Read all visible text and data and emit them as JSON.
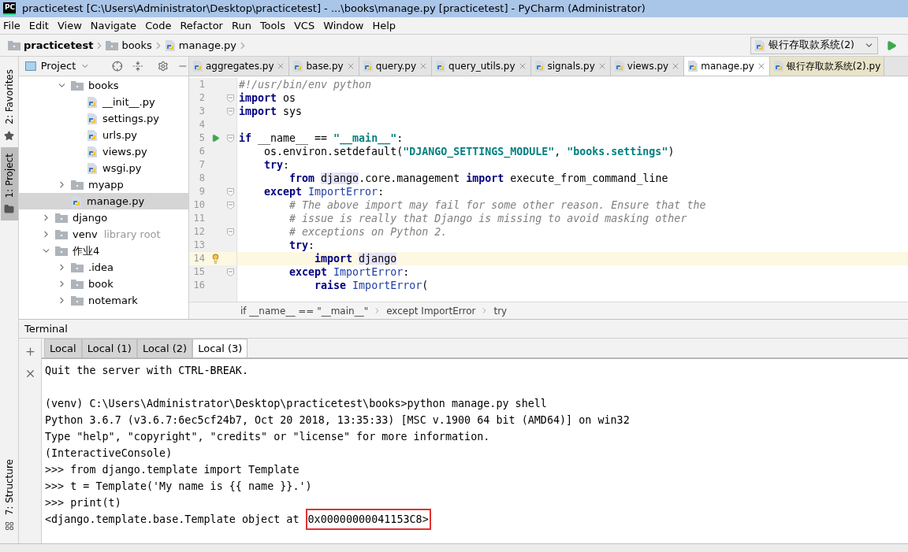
{
  "window": {
    "app_icon": "PC",
    "title": "practicetest [C:\\Users\\Administrator\\Desktop\\practicetest] - ...\\books\\manage.py [practicetest] - PyCharm (Administrator)"
  },
  "menu": [
    "File",
    "Edit",
    "View",
    "Navigate",
    "Code",
    "Refactor",
    "Run",
    "Tools",
    "VCS",
    "Window",
    "Help"
  ],
  "nav_path": [
    {
      "label": "practicetest",
      "kind": "root"
    },
    {
      "label": "books",
      "kind": "folder"
    },
    {
      "label": "manage.py",
      "kind": "python"
    }
  ],
  "run_config": "银行存取款系统(2)",
  "left_stripe": [
    {
      "label": "2: Favorites",
      "kind": "star",
      "selected": false
    },
    {
      "label": "1: Project",
      "kind": "folder",
      "selected": true
    }
  ],
  "bottom_stripe": [
    {
      "label": "7: Structure",
      "kind": "structure",
      "selected": false
    }
  ],
  "project_panel": {
    "title": "Project",
    "scrolled_group": [
      {
        "label": "books",
        "kind": "folder",
        "expanded": true,
        "selected": false,
        "children": [
          {
            "label": "__init__.py",
            "kind": "python",
            "selected": false
          },
          {
            "label": "settings.py",
            "kind": "python",
            "selected": false
          },
          {
            "label": "urls.py",
            "kind": "python",
            "selected": false
          },
          {
            "label": "views.py",
            "kind": "python",
            "selected": false
          },
          {
            "label": "wsgi.py",
            "kind": "python",
            "selected": false
          }
        ]
      },
      {
        "label": "myapp",
        "kind": "folder",
        "expanded": false,
        "selected": false
      },
      {
        "label": "manage.py",
        "kind": "python",
        "selected": true
      }
    ],
    "items": [
      {
        "label": "django",
        "kind": "folder",
        "expanded": false,
        "selected": false
      },
      {
        "label": "venv",
        "hint": "library root",
        "kind": "folder",
        "expanded": false,
        "selected": false
      },
      {
        "label": "作业4",
        "kind": "folder",
        "expanded": true,
        "selected": false,
        "children": [
          {
            "label": ".idea",
            "kind": "folder",
            "expanded": false,
            "selected": false
          },
          {
            "label": "book",
            "kind": "folder",
            "expanded": false,
            "selected": false
          },
          {
            "label": "notemark",
            "kind": "folder",
            "expanded": false,
            "selected": false
          }
        ]
      }
    ]
  },
  "editor_tabs": [
    {
      "label": "aggregates.py",
      "kind": "project",
      "selected": false
    },
    {
      "label": "base.py",
      "kind": "project",
      "selected": false
    },
    {
      "label": "query.py",
      "kind": "project",
      "selected": false
    },
    {
      "label": "query_utils.py",
      "kind": "project",
      "selected": false
    },
    {
      "label": "signals.py",
      "kind": "project",
      "selected": false
    },
    {
      "label": "views.py",
      "kind": "project",
      "selected": false
    },
    {
      "label": "manage.py",
      "kind": "project",
      "selected": true
    },
    {
      "label": "银行存取款系统(2).py",
      "kind": "other",
      "selected": false
    }
  ],
  "code_lines": [
    {
      "n": "1",
      "fold": false,
      "runnable": false,
      "intention": false,
      "current": false,
      "tokens": [
        {
          "t": "#!/usr/bin/env python",
          "kind": "comment"
        }
      ]
    },
    {
      "n": "2",
      "fold": true,
      "runnable": false,
      "intention": false,
      "current": false,
      "tokens": [
        {
          "t": "import ",
          "kind": "keyword"
        },
        {
          "t": "os",
          "kind": "plain"
        }
      ]
    },
    {
      "n": "3",
      "fold": true,
      "runnable": false,
      "intention": false,
      "current": false,
      "tokens": [
        {
          "t": "import ",
          "kind": "keyword"
        },
        {
          "t": "sys",
          "kind": "plain"
        }
      ]
    },
    {
      "n": "4",
      "fold": false,
      "runnable": false,
      "intention": false,
      "current": false
    },
    {
      "n": "5",
      "fold": true,
      "runnable": true,
      "intention": false,
      "current": false,
      "tokens": [
        {
          "t": "if",
          "kind": "keyword"
        },
        {
          "t": " __name__ == ",
          "kind": "plain"
        },
        {
          "t": "\"__main__\"",
          "kind": "string"
        },
        {
          "t": ":",
          "kind": "plain"
        }
      ]
    },
    {
      "n": "6",
      "fold": false,
      "runnable": false,
      "intention": false,
      "current": false,
      "tokens": [
        {
          "t": "    os.environ.setdefault(",
          "kind": "plain"
        },
        {
          "t": "\"DJANGO_SETTINGS_MODULE\"",
          "kind": "string"
        },
        {
          "t": ", ",
          "kind": "plain"
        },
        {
          "t": "\"books.settings\"",
          "kind": "string"
        },
        {
          "t": ")",
          "kind": "plain"
        }
      ]
    },
    {
      "n": "7",
      "fold": false,
      "runnable": false,
      "intention": false,
      "current": false,
      "tokens": [
        {
          "t": "    try",
          "kind": "keyword"
        },
        {
          "t": ":",
          "kind": "plain"
        }
      ]
    },
    {
      "n": "8",
      "fold": false,
      "runnable": false,
      "intention": false,
      "current": false,
      "tokens": [
        {
          "t": "        from ",
          "kind": "keyword"
        },
        {
          "t": "django",
          "kind": "usage"
        },
        {
          "t": ".core.management ",
          "kind": "plain"
        },
        {
          "t": "import",
          "kind": "keyword"
        },
        {
          "t": " execute_from_command_line",
          "kind": "plain"
        }
      ]
    },
    {
      "n": "9",
      "fold": true,
      "runnable": false,
      "intention": false,
      "current": false,
      "tokens": [
        {
          "t": "    except ",
          "kind": "keyword"
        },
        {
          "t": "ImportError",
          "kind": "builtin"
        },
        {
          "t": ":",
          "kind": "plain"
        }
      ]
    },
    {
      "n": "10",
      "fold": true,
      "runnable": false,
      "intention": false,
      "current": false,
      "tokens": [
        {
          "t": "        # The above import may fail for some other reason. Ensure that the",
          "kind": "comment"
        }
      ]
    },
    {
      "n": "11",
      "fold": false,
      "runnable": false,
      "intention": false,
      "current": false,
      "tokens": [
        {
          "t": "        # issue is really that Django is missing to avoid masking other",
          "kind": "comment"
        }
      ]
    },
    {
      "n": "12",
      "fold": true,
      "runnable": false,
      "intention": false,
      "current": false,
      "tokens": [
        {
          "t": "        # exceptions on Python 2.",
          "kind": "comment"
        }
      ]
    },
    {
      "n": "13",
      "fold": false,
      "runnable": false,
      "intention": false,
      "current": false,
      "tokens": [
        {
          "t": "        try",
          "kind": "keyword"
        },
        {
          "t": ":",
          "kind": "plain"
        }
      ]
    },
    {
      "n": "14",
      "fold": false,
      "runnable": false,
      "intention": true,
      "current": true,
      "tokens": [
        {
          "t": "            import ",
          "kind": "keyword"
        },
        {
          "t": "django",
          "kind": "usage"
        }
      ]
    },
    {
      "n": "15",
      "fold": true,
      "runnable": false,
      "intention": false,
      "current": false,
      "tokens": [
        {
          "t": "        except ",
          "kind": "keyword"
        },
        {
          "t": "ImportError",
          "kind": "builtin"
        },
        {
          "t": ":",
          "kind": "plain"
        }
      ]
    },
    {
      "n": "16",
      "fold": false,
      "runnable": false,
      "intention": false,
      "current": false,
      "tokens": [
        {
          "t": "            raise ",
          "kind": "keyword"
        },
        {
          "t": "ImportError",
          "kind": "builtin"
        },
        {
          "t": "(",
          "kind": "plain"
        }
      ]
    }
  ],
  "code_breadcrumbs": [
    "if __name__ == \"__main__\"",
    "except ImportError",
    "try"
  ],
  "terminal": {
    "title": "Terminal",
    "tabs": [
      {
        "label": "Local",
        "selected": false
      },
      {
        "label": "Local (1)",
        "selected": false
      },
      {
        "label": "Local (2)",
        "selected": false
      },
      {
        "label": "Local (3)",
        "selected": true
      }
    ],
    "lines": [
      {
        "kind": "output",
        "text": "Quit the server with CTRL-BREAK."
      },
      {
        "kind": "blank"
      },
      {
        "kind": "output",
        "text": "(venv) C:\\Users\\Administrator\\Desktop\\practicetest\\books>python manage.py shell"
      },
      {
        "kind": "output",
        "text": "Python 3.6.7 (v3.6.7:6ec5cf24b7, Oct 20 2018, 13:35:33) [MSC v.1900 64 bit (AMD64)] on win32"
      },
      {
        "kind": "output",
        "text": "Type \"help\", \"copyright\", \"credits\" or \"license\" for more information."
      },
      {
        "kind": "output",
        "text": "(InteractiveConsole)"
      },
      {
        "kind": "output",
        "text": ">>> from django.template import Template"
      },
      {
        "kind": "output",
        "text": ">>> t = Template('My name is {{ name }}.')"
      },
      {
        "kind": "output",
        "text": ">>> print(t)"
      },
      {
        "kind": "output",
        "text": "<django.template.base.Template object at ",
        "boxed": "0x00000000041153C8>"
      }
    ]
  }
}
